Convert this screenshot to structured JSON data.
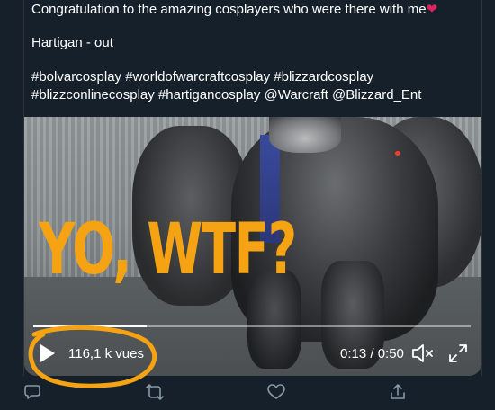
{
  "tweet": {
    "lines": [
      "Congratulation to the amazing cosplayers who were there with me",
      "Hartigan - out",
      "#bolvarcosplay #worldofwarcraftcosplay #blizzardcosplay",
      "#blizzconlinecosplay #hartigancosplay @Warcraft @Blizzard_Ent"
    ],
    "heart": "❤"
  },
  "video": {
    "overlay_text": "YO, WTF?",
    "views": "116,1 k vues",
    "time": "0:13 / 0:50",
    "progress": 0.26,
    "icons": {
      "play": "play-icon",
      "mute": "volume-muted-icon",
      "fullscreen": "fullscreen-icon"
    }
  },
  "actions": {
    "icons": [
      "reply-icon",
      "retweet-icon",
      "like-icon",
      "share-icon"
    ]
  },
  "colors": {
    "background": "#15202b",
    "overlay_text": "#f5a312",
    "annotation": "#f5a312",
    "action_icons": "#8899a6"
  }
}
